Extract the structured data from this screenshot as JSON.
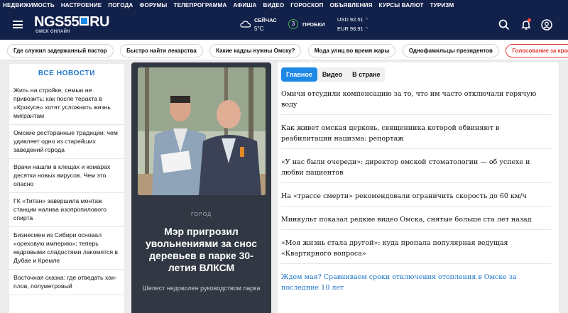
{
  "top_nav": [
    "НЕДВИЖИМОСТЬ",
    "НАСТРОЕНИЕ",
    "ПОГОДА",
    "ФОРУМЫ",
    "ТЕЛЕПРОГРАММА",
    "АФИША",
    "ВИДЕО",
    "ГОРОСКОП",
    "ОБЪЯВЛЕНИЯ",
    "КУРСЫ ВАЛЮТ",
    "ТУРИЗМ"
  ],
  "header": {
    "logo_left": "NGS55",
    "logo_right": "RU",
    "logo_sub": "ОМСК ОНЛАЙН",
    "weather_label": "СЕЙЧАС",
    "weather_temp": "5°С",
    "traffic_level": "3",
    "traffic_label": "ПРОБКИ",
    "usd": "USD 92.51",
    "eur": "EUR 98.91",
    "icons": [
      "menu-icon",
      "cloud-icon",
      "search-icon",
      "bell-icon",
      "profile-icon"
    ],
    "accent": "#12214a",
    "notification_color": "#ff4a3a"
  },
  "tags": [
    "Где служил задержанный пастор",
    "Быстро найти лекарства",
    "Какие кадры нужны Омску?",
    "Мода улиц во время жары",
    "Однофамильцы президентов",
    "Голосование за красавиц Омска"
  ],
  "news": {
    "title": "ВСЕ НОВОСТИ",
    "items": [
      "Жить на стройке, семью не привозить: как после теракта в «Крокусе» хотят усложнить жизнь мигрантам",
      "Омские ресторанные традиции: чем удивляет одно из старейших заведений города",
      "Врачи нашли в клещах и комарах десятки новых вирусов. Чем это опасно",
      "ГК «Титан» завершила монтаж станции налива изопропилового спирта",
      "Бизнесмен из Сибири основал «ореховую империю»: теперь кедровыми сладостями лакомятся в Дубае и Кремле",
      "Восточная сказка: где отведать хан-плов, полуметровый"
    ]
  },
  "feature": {
    "rubric": "ГОРОД",
    "title": "Мэр пригрозил увольнениями за снос деревьев в парке 30-летия ВЛКСМ",
    "subtitle": "Шелест недоволен руководством парка"
  },
  "main": {
    "tabs": [
      "Главное",
      "Видео",
      "В стране"
    ],
    "active_tab": "Главное",
    "headlines": [
      "Омичи отсудили компенсацию за то, что им часто отключали горячую воду",
      "Как живет омская церковь, священника которой обвиняют в реабилитации нацизма: репортаж",
      "«У нас были очереди»: директор омской стоматологии — об успехе и любви пациентов",
      "На «трассе смерти» рекомендовали ограничить скорость до 60 км/ч",
      "Минкульт показал редкие видео Омска, снятые больше ста лет назад",
      "«Моя жизнь стала другой»: куда пропала популярная ведущая «Квартирного вопроса»",
      "Ждем мая? Сравниваем сроки отключения отопления в Омске за последние 10 лет"
    ]
  }
}
